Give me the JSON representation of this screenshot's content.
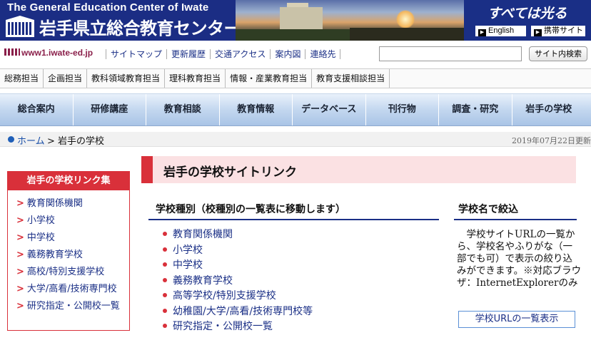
{
  "header": {
    "org_en": "The General Education Center of Iwate",
    "org_jp": "岩手県立総合教育センター",
    "slogan": "すべては光る",
    "english_label": "English",
    "mobile_label": "携帯サイト"
  },
  "utility": {
    "url_label": "www1.iwate-ed.jp",
    "links": [
      "サイトマップ",
      "更新履歴",
      "交通アクセス",
      "案内図",
      "連絡先"
    ],
    "search_placeholder": "",
    "search_button": "サイト内検索"
  },
  "subnav": [
    "総務担当",
    "企画担当",
    "教科領域教育担当",
    "理科教育担当",
    "情報・産業教育担当",
    "教育支援相談担当"
  ],
  "global_nav": [
    "総合案内",
    "研修講座",
    "教育相談",
    "教育情報",
    "データベース",
    "刊行物",
    "調査・研究",
    "岩手の学校"
  ],
  "breadcrumb": {
    "home": "ホーム",
    "separator": ">",
    "current": "岩手の学校",
    "updated": "2019年07月22日更新"
  },
  "sidebar": {
    "title": "岩手の学校リンク集",
    "items": [
      "教育関係機関",
      "小学校",
      "中学校",
      "義務教育学校",
      "高校/特別支援学校",
      "大学/高看/技術専門校",
      "研究指定・公開校一覧"
    ]
  },
  "main": {
    "page_title": "岩手の学校サイトリンク",
    "types_heading": "学校種別（校種別の一覧表に移動します）",
    "types": [
      "教育関係機関",
      "小学校",
      "中学校",
      "義務教育学校",
      "高等学校/特別支援学校",
      "幼稚園/大学/高看/技術専門校等",
      "研究指定・公開校一覧"
    ],
    "filter_heading": "学校名で絞込",
    "filter_text": "学校サイトURLの一覧から、学校名やふりがな（一部でも可）で表示の絞り込みができます。※対応ブラウザ：InternetExplorerのみ",
    "filter_button": "学校URLの一覧表示"
  }
}
